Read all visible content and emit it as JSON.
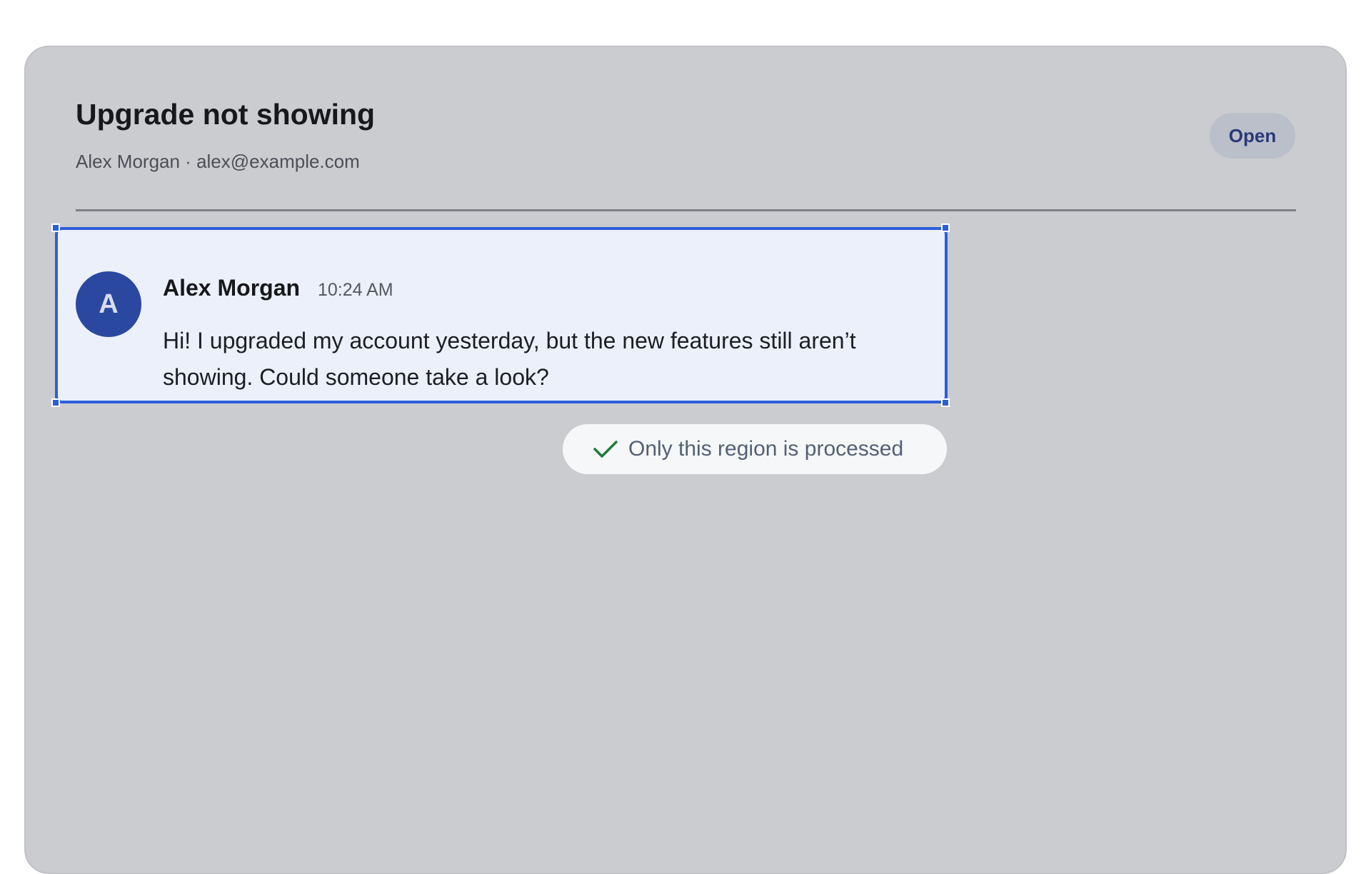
{
  "ticket": {
    "title": "Upgrade not showing",
    "requester": "Alex Morgan · alex@example.com",
    "status": "Open"
  },
  "message": {
    "avatar_initial": "A",
    "author": "Alex Morgan",
    "time": "10:24 AM",
    "body": "Hi! I upgraded my account yesterday, but the new features still aren’t showing. Could someone take a look?"
  },
  "notice": {
    "icon": "check-icon",
    "text": "Only this region is processed"
  },
  "colors": {
    "selection_accent": "#2b5fd9",
    "check_green": "#1e7a3a",
    "avatar_bg": "#2a48a0"
  }
}
